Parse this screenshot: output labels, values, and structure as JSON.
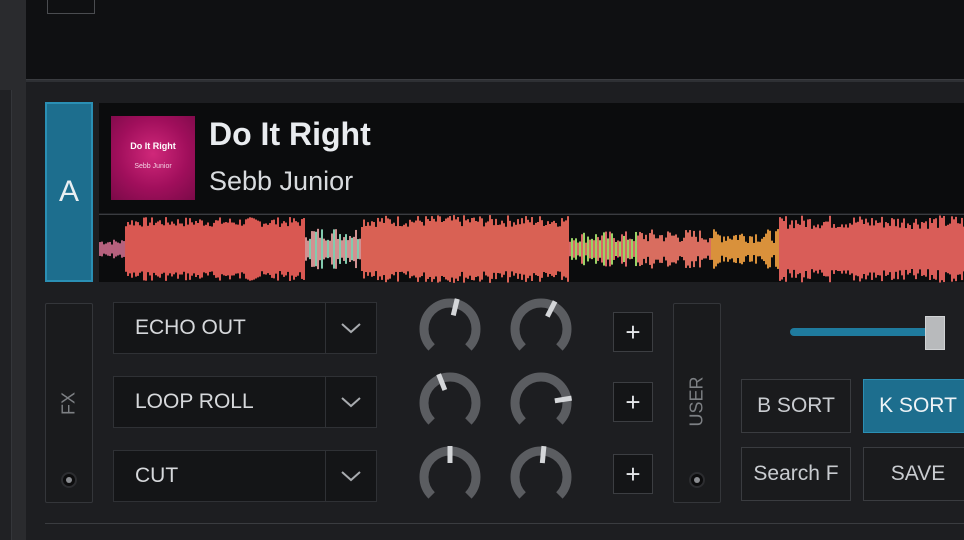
{
  "deck": {
    "letter": "A",
    "track_title": "Do It Right",
    "track_artist": "Sebb Junior",
    "cover": {
      "title": "Do It Right",
      "artist": "Sebb Junior",
      "color": "#b3156a"
    },
    "accent_color": "#1d6e8e"
  },
  "fx": {
    "side_label": "FX",
    "slots": [
      {
        "label": "ECHO OUT",
        "arrow_icon": "chevron-down-icon",
        "knob1_level": 0.55,
        "knob2_level": 0.6,
        "add_label": "+"
      },
      {
        "label": "LOOP ROLL",
        "arrow_icon": "chevron-down-icon",
        "knob1_level": 0.42,
        "knob2_level": 0.8,
        "add_label": "+"
      },
      {
        "label": "CUT",
        "arrow_icon": "chevron-down-icon",
        "knob1_level": 0.5,
        "knob2_level": 0.52,
        "add_label": "+"
      }
    ]
  },
  "user_panel": {
    "side_label": "USER",
    "slider_level": 0.97,
    "buttons": [
      {
        "label": "B SORT",
        "active": false
      },
      {
        "label": "K SORT",
        "active": true
      },
      {
        "label": "Search F",
        "active": false
      },
      {
        "label": "SAVE",
        "active": false
      }
    ]
  }
}
